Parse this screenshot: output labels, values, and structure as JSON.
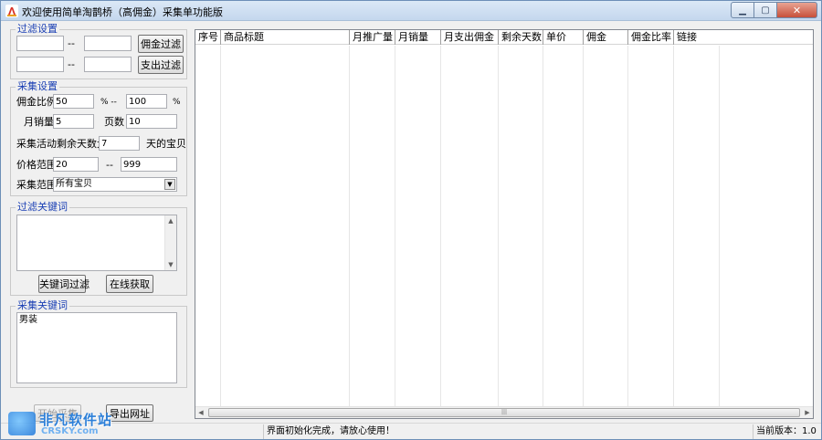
{
  "window": {
    "title": "欢迎使用简单淘鹊桥（高佣金）采集单功能版",
    "min_glyph": "▁",
    "max_glyph": "▢",
    "close_glyph": "✕"
  },
  "icons": {
    "app": "app-logo-icon",
    "dropdown": "chevron-down-icon",
    "scroll_up": "arrow-up-icon",
    "scroll_down": "arrow-down-icon",
    "scroll_left": "arrow-left-icon",
    "scroll_right": "arrow-right-icon"
  },
  "filter_settings": {
    "legend": "过滤设置",
    "row1": {
      "min": "",
      "sep": "--",
      "max": "",
      "button": "佣金过滤"
    },
    "row2": {
      "min": "",
      "sep": "--",
      "max": "",
      "button": "支出过滤"
    }
  },
  "collect_settings": {
    "legend": "采集设置",
    "commission_ratio_label": "佣金比例",
    "commission_ratio_min": "50",
    "percent_sep": "% --",
    "commission_ratio_max": "100",
    "percent": "%",
    "monthly_sales_label": "月销量",
    "monthly_sales_value": "5",
    "pages_label": "页数",
    "pages_value": "10",
    "days_left_label": "采集活动剩余天数大于",
    "days_left_value": "7",
    "days_left_unit": "天的宝贝",
    "price_range_label": "价格范围",
    "price_min": "20",
    "price_sep": "--",
    "price_max": "999",
    "scope_label": "采集范围",
    "scope_value": "所有宝贝"
  },
  "filter_keywords": {
    "legend": "过滤关键词",
    "text": "",
    "keyword_filter_button": "关键词过滤",
    "online_fetch_button": "在线获取"
  },
  "collect_keywords": {
    "legend": "采集关键词",
    "text": "男装"
  },
  "actions": {
    "start_button": "开始采集",
    "export_button": "导出网址"
  },
  "grid": {
    "columns": [
      "序号",
      "商品标题",
      "月推广量",
      "月销量",
      "月支出佣金",
      "剩余天数",
      "单价",
      "佣金",
      "佣金比率",
      "链接"
    ],
    "rows": []
  },
  "status": {
    "left": "",
    "message": "界面初始化完成，请放心使用！",
    "version": "当前版本：1.0"
  },
  "watermark": {
    "cn": "非凡软件站",
    "en": "CRSKY.com"
  }
}
